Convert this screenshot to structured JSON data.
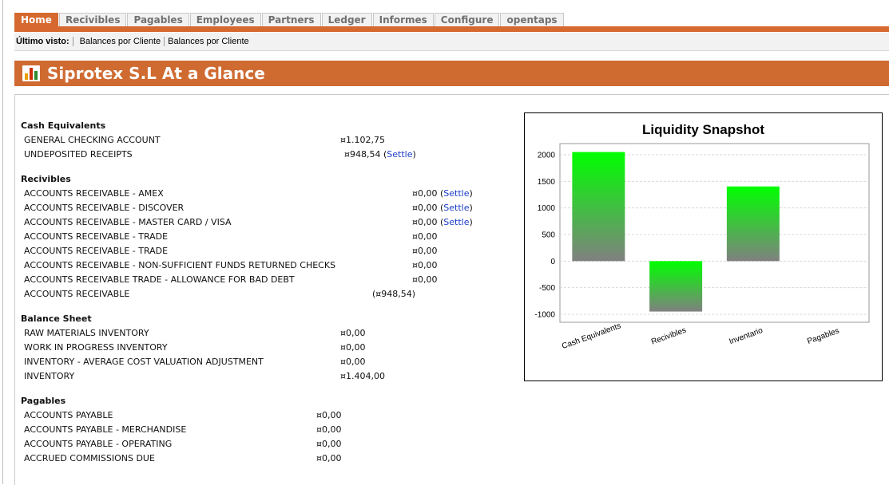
{
  "tabs": [
    {
      "label": "Home",
      "active": true
    },
    {
      "label": "Recivibles"
    },
    {
      "label": "Pagables"
    },
    {
      "label": "Employees"
    },
    {
      "label": "Partners"
    },
    {
      "label": "Ledger"
    },
    {
      "label": "Informes"
    },
    {
      "label": "Configure"
    },
    {
      "label": "opentaps"
    }
  ],
  "last_viewed": {
    "label": "Último visto:",
    "links": [
      "Balances por Cliente",
      "Balances por Cliente"
    ]
  },
  "page": {
    "title": "Siprotex S.L At a Glance",
    "title_icon": "bar-chart-icon"
  },
  "colors": {
    "accent": "#cf6a30",
    "link": "#1a3cc8",
    "bar_top": "#00ff00",
    "bar_bottom": "#808080"
  },
  "sections": [
    {
      "heading": "Cash Equivalents",
      "rows": [
        {
          "name": "GENERAL CHECKING ACCOUNT",
          "amount": "¤1.102,75"
        },
        {
          "name": "UNDEPOSITED RECEIPTS",
          "amount": "¤948,54",
          "action": "Settle"
        }
      ]
    },
    {
      "heading": "Recivibles",
      "rows": [
        {
          "name": "ACCOUNTS RECEIVABLE - AMEX",
          "amount": "¤0,00",
          "action": "Settle"
        },
        {
          "name": "ACCOUNTS RECEIVABLE - DISCOVER",
          "amount": "¤0,00",
          "action": "Settle"
        },
        {
          "name": "ACCOUNTS RECEIVABLE - MASTER CARD / VISA",
          "amount": "¤0,00",
          "action": "Settle"
        },
        {
          "name": "ACCOUNTS RECEIVABLE - TRADE",
          "amount": "¤0,00"
        },
        {
          "name": "ACCOUNTS RECEIVABLE - TRADE",
          "amount": "¤0,00"
        },
        {
          "name": "ACCOUNTS RECEIVABLE - NON-SUFFICIENT FUNDS RETURNED CHECKS",
          "amount": "¤0,00"
        },
        {
          "name": "ACCOUNTS RECEIVABLE TRADE - ALLOWANCE FOR BAD DEBT",
          "amount": "¤0,00"
        },
        {
          "name": "ACCOUNTS RECEIVABLE",
          "amount": "(¤948,54)"
        }
      ]
    },
    {
      "heading": "Balance Sheet",
      "rows": [
        {
          "name": "RAW MATERIALS INVENTORY",
          "amount": "¤0,00"
        },
        {
          "name": "WORK IN PROGRESS INVENTORY",
          "amount": "¤0,00"
        },
        {
          "name": "INVENTORY - AVERAGE COST VALUATION ADJUSTMENT",
          "amount": "¤0,00"
        },
        {
          "name": "INVENTORY",
          "amount": "¤1.404,00"
        }
      ]
    },
    {
      "heading": "Pagables",
      "rows": [
        {
          "name": "ACCOUNTS PAYABLE",
          "amount": "¤0,00"
        },
        {
          "name": "ACCOUNTS PAYABLE - MERCHANDISE",
          "amount": "¤0,00"
        },
        {
          "name": "ACCOUNTS PAYABLE - OPERATING",
          "amount": "¤0,00"
        },
        {
          "name": "ACCRUED COMMISSIONS DUE",
          "amount": "¤0,00"
        }
      ]
    }
  ],
  "chart_data": {
    "type": "bar",
    "title": "Liquidity Snapshot",
    "categories": [
      "Cash Equivalents",
      "Recivibles",
      "Inventario",
      "Pagables"
    ],
    "values": [
      2051.29,
      -948.54,
      1404.0,
      0
    ],
    "ylim": [
      -1000,
      2000
    ],
    "yticks": [
      2000,
      1500,
      1000,
      500,
      0,
      -500,
      -1000
    ],
    "grid": true,
    "xlabel": "",
    "ylabel": ""
  }
}
